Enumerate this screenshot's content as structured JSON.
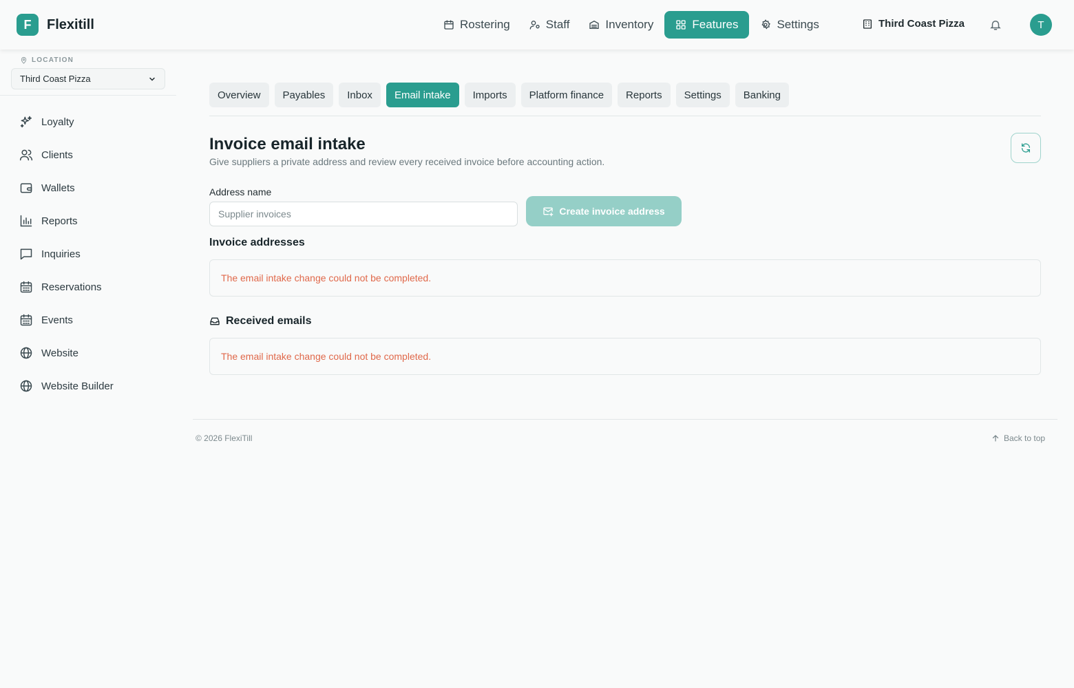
{
  "brand": {
    "initial": "F",
    "name": "Flexitill"
  },
  "topnav": {
    "items": [
      {
        "label": "Rostering",
        "icon": "calendar-icon"
      },
      {
        "label": "Staff",
        "icon": "staff-icon"
      },
      {
        "label": "Inventory",
        "icon": "inventory-icon"
      },
      {
        "label": "Features",
        "icon": "grid-icon",
        "active": true
      },
      {
        "label": "Settings",
        "icon": "gear-icon"
      }
    ],
    "location": "Third Coast Pizza",
    "avatar_initial": "T"
  },
  "sidebar": {
    "location_label": "LOCATION",
    "location_value": "Third Coast Pizza",
    "items": [
      {
        "label": "Loyalty",
        "icon": "sparkles-icon"
      },
      {
        "label": "Clients",
        "icon": "users-icon"
      },
      {
        "label": "Wallets",
        "icon": "wallet-icon"
      },
      {
        "label": "Reports",
        "icon": "bar-chart-icon"
      },
      {
        "label": "Inquiries",
        "icon": "message-icon"
      },
      {
        "label": "Reservations",
        "icon": "calendar-grid-icon"
      },
      {
        "label": "Events",
        "icon": "calendar-grid-icon"
      },
      {
        "label": "Website",
        "icon": "globe-icon"
      },
      {
        "label": "Website Builder",
        "icon": "globe-icon"
      }
    ]
  },
  "tabs": [
    {
      "label": "Overview"
    },
    {
      "label": "Payables"
    },
    {
      "label": "Inbox"
    },
    {
      "label": "Email intake",
      "active": true
    },
    {
      "label": "Imports"
    },
    {
      "label": "Platform finance"
    },
    {
      "label": "Reports"
    },
    {
      "label": "Settings"
    },
    {
      "label": "Banking"
    }
  ],
  "main": {
    "title": "Invoice email intake",
    "subtitle": "Give suppliers a private address and review every received invoice before accounting action.",
    "address_label": "Address name",
    "address_placeholder": "Supplier invoices",
    "create_button": "Create invoice address",
    "addresses_title": "Invoice addresses",
    "addresses_error": "The email intake change could not be completed.",
    "received_title": "Received emails",
    "received_error": "The email intake change could not be completed."
  },
  "footer": {
    "copyright": "© 2026 FlexiTill",
    "back_to_top": "Back to top"
  },
  "colors": {
    "accent": "#2a9d8f",
    "accent_disabled": "#95cfc7",
    "error": "#e0684a"
  }
}
